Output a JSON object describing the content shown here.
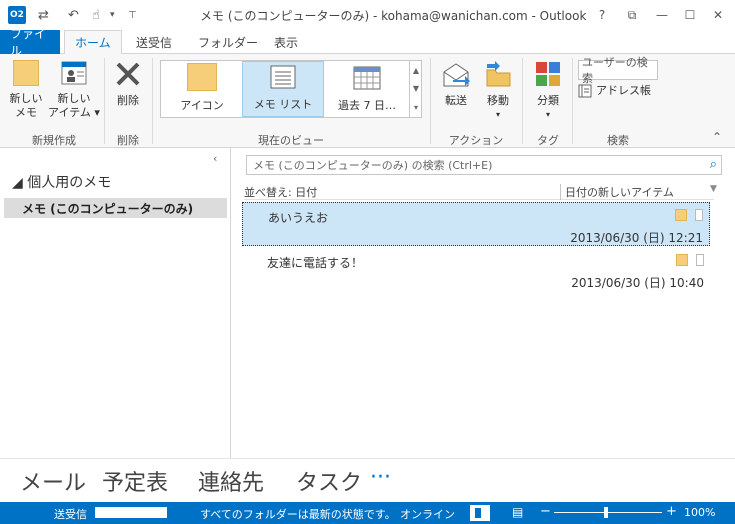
{
  "window": {
    "title": "メモ (このコンピューターのみ) - kohama@wanichan.com - Outlook",
    "logo": "O2",
    "help": "?",
    "restore": "⧉",
    "minimize": "—",
    "maximize": "☐",
    "close": "✕"
  },
  "qat": {
    "send_receive": "⇄",
    "undo": "↶",
    "touch": "☝",
    "more": "▾"
  },
  "tabs": [
    "ファイル",
    "ホーム",
    "送受信",
    "フォルダー",
    "表示"
  ],
  "ribbon": {
    "new_note": "新しい\nメモ",
    "new_note_l1": "新しい",
    "new_note_l2": "メモ",
    "new_items_l1": "新しい",
    "new_items_l2": "アイテム ▾",
    "group_new": "新規作成",
    "delete": "削除",
    "group_delete": "削除",
    "view_icon": "アイコン",
    "view_list": "メモ リスト",
    "view_last7": "過去 7 日…",
    "group_view": "現在のビュー",
    "forward": "転送",
    "move": "移動",
    "move_drop": "▾",
    "group_actions": "アクション",
    "categorize": "分類",
    "categorize_drop": "▾",
    "group_tags": "タグ",
    "search_people": "ユーザーの検索",
    "address_book": "アドレス帳",
    "group_find": "検索",
    "collapse": "⌃"
  },
  "folders": {
    "heading": "◢ 個人用のメモ",
    "item": "メモ (このコンピューターのみ)",
    "collapse": "‹"
  },
  "list": {
    "search_placeholder": "メモ (このコンピューターのみ) の検索 (Ctrl+E)",
    "sort_by": "並べ替え: 日付",
    "sort_order": "日付の新しいアイテム",
    "sort_arrow": "▼",
    "notes": [
      {
        "title": "あいうえお",
        "date": "2013/06/30 (日) 12:21"
      },
      {
        "title": "友達に電話する！",
        "date": "2013/06/30 (日) 10:40"
      }
    ]
  },
  "nav": {
    "mail": "メール",
    "calendar": "予定表",
    "people": "連絡先",
    "tasks": "タスク",
    "more": "···"
  },
  "status": {
    "send_receive": "送受信",
    "message": "すべてのフォルダーは最新の状態です。",
    "connection": "オンライン",
    "zoom_out": "−",
    "zoom_in": "+",
    "zoom": "100%",
    "progress": 1.0,
    "zoom_level": 0.5
  },
  "colors": {
    "accent": "#0072c6",
    "note": "#f6ce7a",
    "selection": "#cde6f7"
  }
}
